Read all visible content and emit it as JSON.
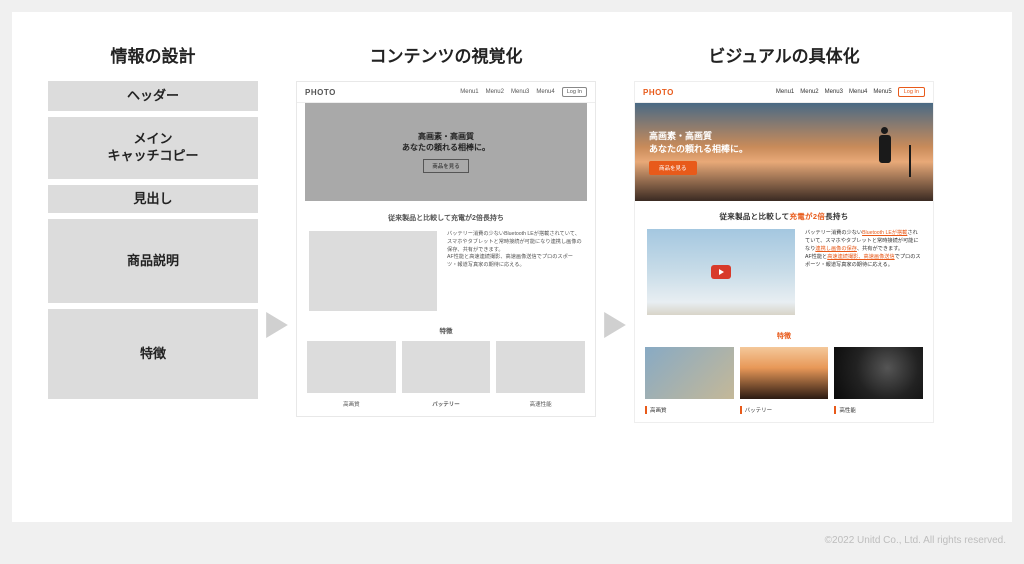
{
  "columns": {
    "col1": {
      "title": "情報の設計"
    },
    "col2": {
      "title": "コンテンツの視覚化"
    },
    "col3": {
      "title": "ビジュアルの具体化"
    }
  },
  "blocks": {
    "header": "ヘッダー",
    "main_copy": "メイン\nキャッチコピー",
    "heading": "見出し",
    "product_desc": "商品説明",
    "features": "特徴"
  },
  "wireframe": {
    "logo": "PHOTO",
    "nav": [
      "Menu1",
      "Menu2",
      "Menu3",
      "Menu4"
    ],
    "login": "Log In",
    "hero_line1": "高画素・高画質",
    "hero_line2": "あなたの頼れる相棒に。",
    "hero_btn": "商品を見る",
    "heading": "従来製品と比較して充電が2倍長持ち",
    "body": "バッテリー消費の少ないBluetooth LEが搭載されていて、スマホやタブレットと常時接続が可能になり連携し画像の保存、共有ができます。\nAF性能と高速連続撮影、高速画像送信でプロのスポーツ・報道写真家の期待に応える。",
    "features_title": "特徴",
    "feature_labels": [
      "高画質",
      "バッテリー",
      "高速性能"
    ]
  },
  "mockup": {
    "logo": "PHOTO",
    "nav": [
      "Menu1",
      "Menu2",
      "Menu3",
      "Menu4",
      "Menu5"
    ],
    "login": "Log In",
    "hero_line1": "高画素・高画質",
    "hero_line2": "あなたの頼れる相棒に。",
    "hero_btn": "商品を見る",
    "heading_pre": "従来製品と比較して",
    "heading_hl": "充電が2倍",
    "heading_post": "長持ち",
    "body_p1a": "バッテリー消費の少ない",
    "body_p1b": "Bluetooth LEが搭載",
    "body_p1c": "されていて、スマホやタブレットと常時接続が可能になり",
    "body_p1d": "連携し画像の保存",
    "body_p1e": "、共有ができます。",
    "body_p2a": "AF性能と",
    "body_p2b": "高速連続撮影、高速画像送信",
    "body_p2c": "でプロのスポーツ・報道写真家の期待に応える。",
    "features_title": "特徴",
    "feature_labels": [
      "高画質",
      "バッテリー",
      "高性能"
    ]
  },
  "copyright": "©2022 Unitd Co., Ltd. All rights reserved."
}
